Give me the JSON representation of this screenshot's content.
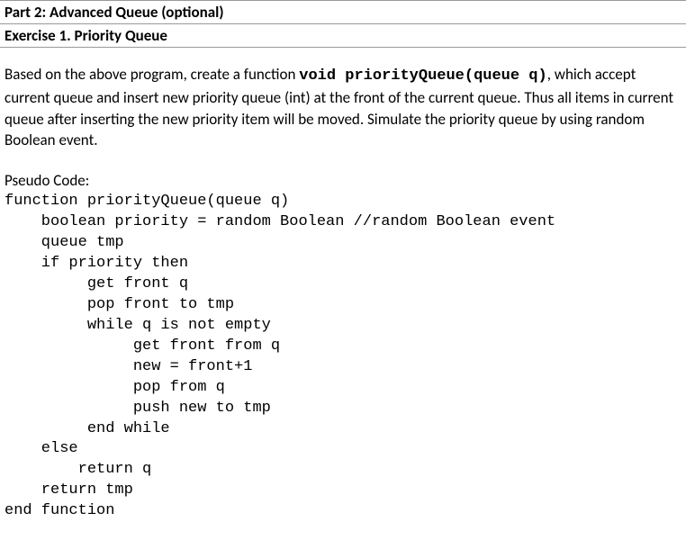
{
  "header": {
    "part_title": "Part 2: Advanced Queue (optional)",
    "exercise_title": "Exercise 1. Priority Queue"
  },
  "description": {
    "prefix": "Based on the above program, create a function ",
    "func_signature": "void priorityQueue(queue q)",
    "suffix": ", which accept current queue and insert new priority queue (int) at the front of the current queue. Thus all items in current queue after inserting the new priority item will be moved. Simulate the priority queue by using random Boolean event."
  },
  "pseudo": {
    "label": "Pseudo Code:",
    "lines": {
      "l0": "function priorityQueue(queue q)",
      "l1": "    boolean priority = random Boolean //random Boolean event",
      "l2": "    queue tmp",
      "l3": "    if priority then",
      "l4": "         get front q",
      "l5": "         pop front to tmp",
      "l6": "         while q is not empty",
      "l7": "              get front from q",
      "l8": "              new = front+1",
      "l9": "              pop from q",
      "l10": "              push new to tmp",
      "l11": "         end while",
      "l12": "    else",
      "l13": "        return q",
      "l14": "",
      "l15": "    return tmp",
      "l16": "end function"
    }
  }
}
